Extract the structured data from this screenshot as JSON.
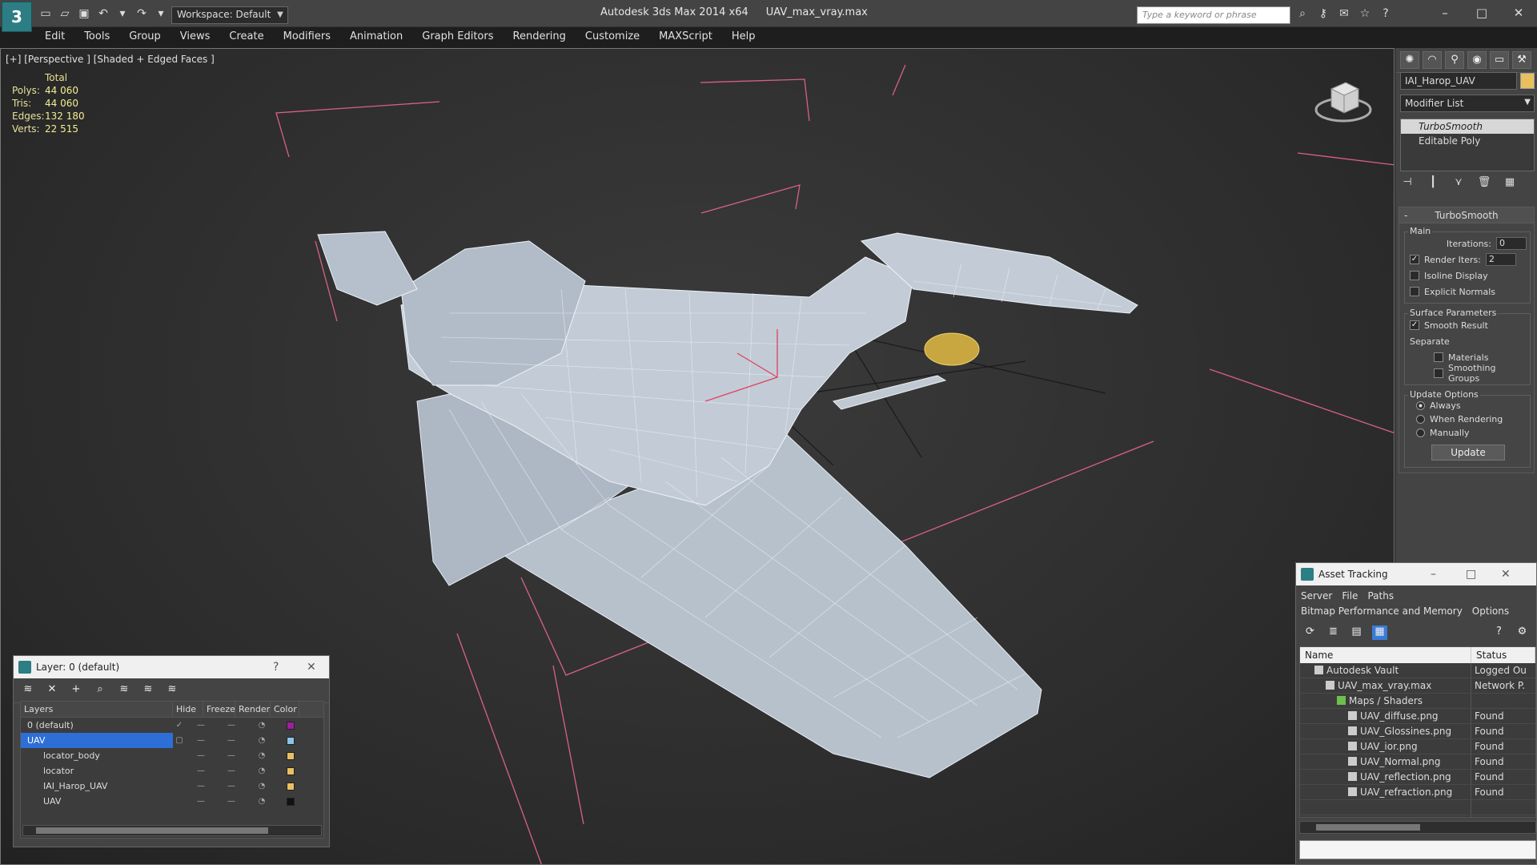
{
  "app": {
    "title": "Autodesk 3ds Max  2014 x64",
    "file": "UAV_max_vray.max",
    "workspace": "Workspace: Default",
    "search_placeholder": "Type a keyword or phrase"
  },
  "menu": [
    "Edit",
    "Tools",
    "Group",
    "Views",
    "Create",
    "Modifiers",
    "Animation",
    "Graph Editors",
    "Rendering",
    "Customize",
    "MAXScript",
    "Help"
  ],
  "viewport": {
    "label": "[+] [Perspective ] [Shaded + Edged Faces ]",
    "stats_header": "Total",
    "stats": [
      {
        "key": "Polys:",
        "value": "44 060"
      },
      {
        "key": "Tris:",
        "value": "44 060"
      },
      {
        "key": "Edges:",
        "value": "132 180"
      },
      {
        "key": "Verts:",
        "value": "22 515"
      }
    ]
  },
  "command_panel": {
    "object_name": "IAI_Harop_UAV",
    "modifier_list": "Modifier List",
    "stack": [
      "TurboSmooth",
      "Editable Poly"
    ],
    "rollout_title": "TurboSmooth",
    "main_group": "Main",
    "iterations_label": "Iterations:",
    "iterations_value": "0",
    "render_iters_label": "Render Iters:",
    "render_iters_value": "2",
    "isoline": "Isoline Display",
    "explicit_normals": "Explicit Normals",
    "surface_group": "Surface Parameters",
    "smooth_result": "Smooth Result",
    "separate": "Separate",
    "materials": "Materials",
    "smoothing_groups": "Smoothing Groups",
    "update_group": "Update Options",
    "always": "Always",
    "when_rendering": "When Rendering",
    "manually": "Manually",
    "update_button": "Update"
  },
  "layer_panel": {
    "title": "Layer: 0 (default)",
    "help": "?",
    "columns": [
      "Layers",
      "Hide",
      "Freeze",
      "Render",
      "Color"
    ],
    "rows": [
      {
        "name": "0 (default)",
        "color": "#9b1fa0",
        "current": true
      },
      {
        "name": "UAV",
        "color": "#87c6e8",
        "selected": true
      },
      {
        "name": "locator_body",
        "color": "#e8c060"
      },
      {
        "name": "locator",
        "color": "#e8c060"
      },
      {
        "name": "IAI_Harop_UAV",
        "color": "#e8c060"
      },
      {
        "name": "UAV",
        "color": "#111111"
      }
    ]
  },
  "asset_panel": {
    "title": "Asset Tracking",
    "menu1": [
      "Server",
      "File",
      "Paths"
    ],
    "menu2": [
      "Bitmap Performance and Memory",
      "Options"
    ],
    "col_name": "Name",
    "col_status": "Status",
    "rows": [
      {
        "name": "Autodesk Vault",
        "status": "Logged Ou",
        "indent": 1
      },
      {
        "name": "UAV_max_vray.max",
        "status": "Network P.",
        "indent": 2
      },
      {
        "name": "Maps / Shaders",
        "status": "",
        "indent": 3
      },
      {
        "name": "UAV_diffuse.png",
        "status": "Found",
        "indent": 4
      },
      {
        "name": "UAV_Glossines.png",
        "status": "Found",
        "indent": 4
      },
      {
        "name": "UAV_ior.png",
        "status": "Found",
        "indent": 4
      },
      {
        "name": "UAV_Normal.png",
        "status": "Found",
        "indent": 4
      },
      {
        "name": "UAV_reflection.png",
        "status": "Found",
        "indent": 4
      },
      {
        "name": "UAV_refraction.png",
        "status": "Found",
        "indent": 4
      }
    ]
  }
}
